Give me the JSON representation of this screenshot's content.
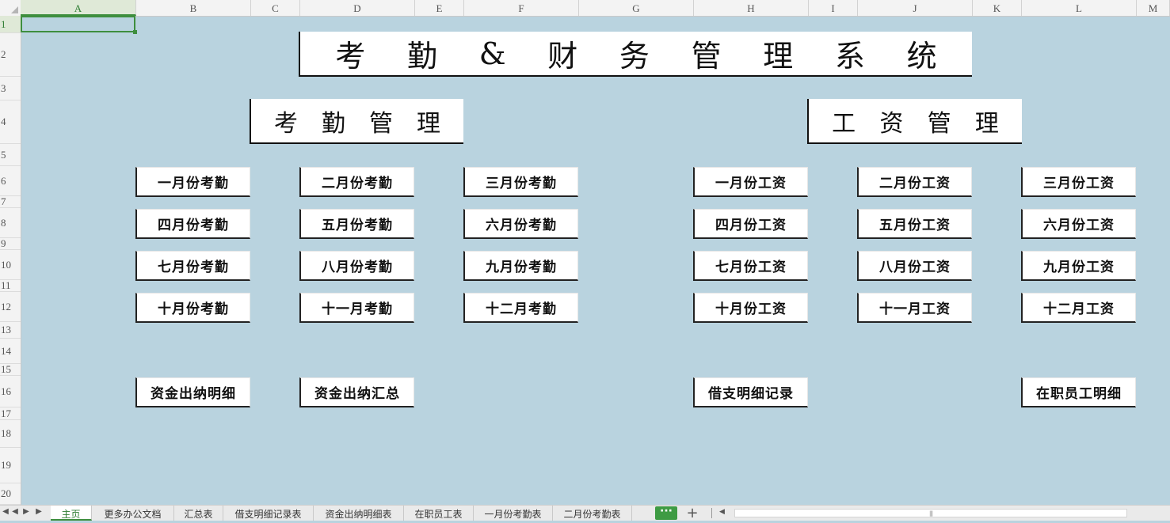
{
  "columns": [
    "A",
    "B",
    "C",
    "D",
    "E",
    "F",
    "G",
    "H",
    "I",
    "J",
    "K",
    "L",
    "M"
  ],
  "rows": [
    "1",
    "2",
    "3",
    "4",
    "5",
    "6",
    "7",
    "8",
    "9",
    "10",
    "11",
    "12",
    "13",
    "14",
    "15",
    "16",
    "17",
    "18",
    "19",
    "20"
  ],
  "selected_cell": "A1",
  "main_title_chars": [
    "考",
    "勤",
    "&",
    "财",
    "务",
    "管",
    "理",
    "系",
    "统"
  ],
  "section_attendance_chars": [
    "考",
    "勤",
    "管",
    "理"
  ],
  "section_salary_chars": [
    "工",
    "资",
    "管",
    "理"
  ],
  "attendance_buttons": [
    "一月份考勤",
    "二月份考勤",
    "三月份考勤",
    "四月份考勤",
    "五月份考勤",
    "六月份考勤",
    "七月份考勤",
    "八月份考勤",
    "九月份考勤",
    "十月份考勤",
    "十一月考勤",
    "十二月考勤"
  ],
  "salary_buttons": [
    "一月份工资",
    "二月份工资",
    "三月份工资",
    "四月份工资",
    "五月份工资",
    "六月份工资",
    "七月份工资",
    "八月份工资",
    "九月份工资",
    "十月份工资",
    "十一月工资",
    "十二月工资"
  ],
  "extra_buttons": {
    "cash_detail": "资金出纳明细",
    "cash_summary": "资金出纳汇总",
    "loan_record": "借支明细记录",
    "employee_detail": "在职员工明细"
  },
  "sheet_tabs": [
    "主页",
    "更多办公文档",
    "汇总表",
    "借支明细记录表",
    "资金出纳明细表",
    "在职员工表",
    "一月份考勤表",
    "二月份考勤表"
  ],
  "active_sheet": "主页",
  "more_tabs_label": "···",
  "add_sheet_label": "+",
  "colors": {
    "sheet_background": "#b9d3df",
    "selection_green": "#3e8e3e",
    "button_face": "#ffffff"
  },
  "icons": [
    "first-sheet-icon",
    "prev-sheet-icon",
    "next-sheet-icon",
    "last-sheet-icon",
    "add-sheet-icon",
    "scroll-left-icon"
  ]
}
